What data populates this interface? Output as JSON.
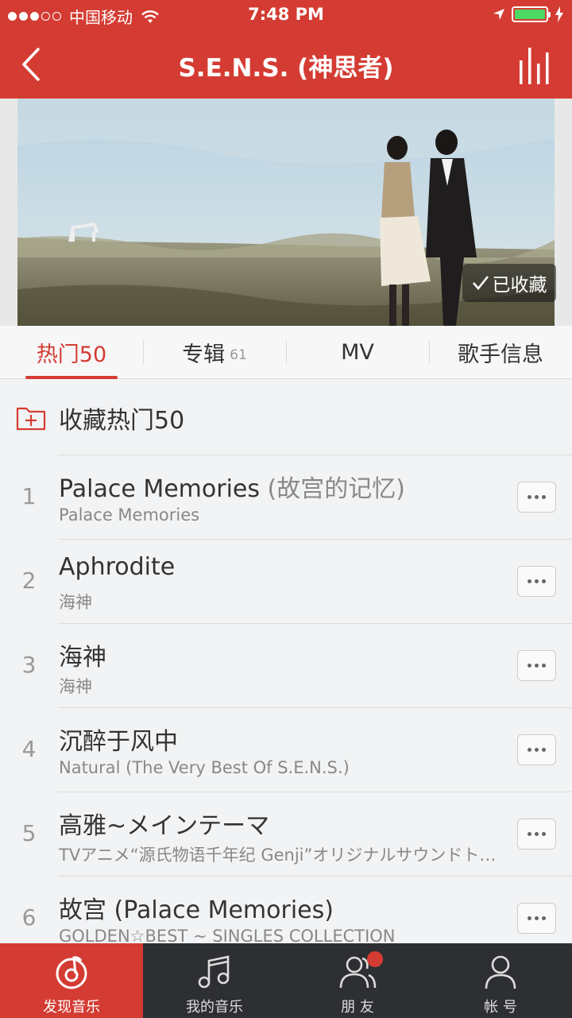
{
  "status_bar": {
    "carrier": "中国移动",
    "time": "7:48 PM"
  },
  "nav": {
    "title": "S.E.N.S. (神思者)"
  },
  "hero": {
    "favorite_label": "已收藏"
  },
  "tabs": [
    {
      "label": "热门50",
      "count": ""
    },
    {
      "label": "专辑",
      "count": "61"
    },
    {
      "label": "MV",
      "count": ""
    },
    {
      "label": "歌手信息",
      "count": ""
    }
  ],
  "collect": {
    "label": "收藏热门50"
  },
  "songs": [
    {
      "index": "1",
      "title": "Palace Memories",
      "alt_title": " (故宫的记忆)",
      "subtitle": "Palace Memories"
    },
    {
      "index": "2",
      "title": "Aphrodite",
      "alt_title": "",
      "subtitle": "海神"
    },
    {
      "index": "3",
      "title": "海神",
      "alt_title": "",
      "subtitle": "海神"
    },
    {
      "index": "4",
      "title": "沉醉于风中",
      "alt_title": "",
      "subtitle": "Natural (The Very Best Of S.E.N.S.)"
    },
    {
      "index": "5",
      "title": "高雅~メインテーマ",
      "alt_title": "",
      "subtitle": "TVアニメ“源氏物语千年纪 Genji”オリジナルサウンドトラック"
    },
    {
      "index": "6",
      "title": "故宫 (Palace Memories)",
      "alt_title": "",
      "subtitle": "GOLDEN☆BEST ~ SINGLES COLLECTION"
    }
  ],
  "tab_bar": [
    {
      "label": "发现音乐",
      "icon": "music-discover-icon"
    },
    {
      "label": "我的音乐",
      "icon": "music-note-icon"
    },
    {
      "label": "朋 友",
      "icon": "friends-icon"
    },
    {
      "label": "帐 号",
      "icon": "account-icon"
    }
  ],
  "colors": {
    "accent": "#d43c33",
    "tab_bar_bg": "#2d2f32",
    "battery": "#4cd964"
  }
}
